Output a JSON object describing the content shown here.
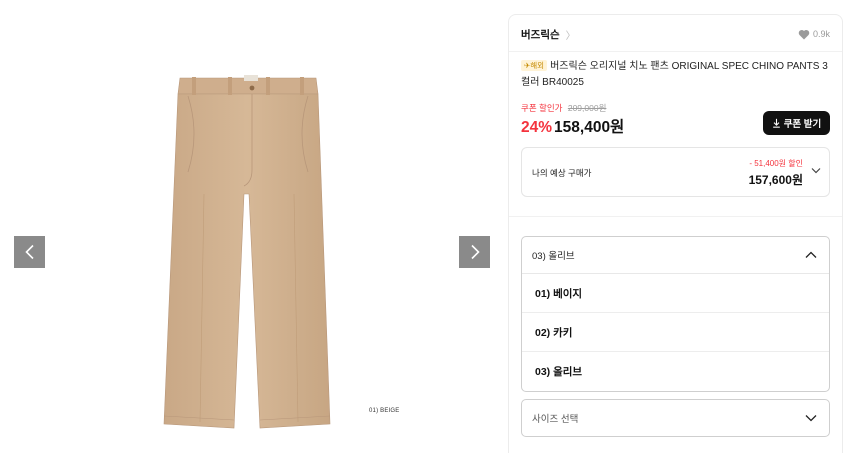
{
  "gallery": {
    "image_caption": "01) BEIGE",
    "product_color": "#d2b392"
  },
  "brand": {
    "name": "버즈릭슨",
    "chevron": "〉"
  },
  "likes": {
    "count": "0.9k"
  },
  "product": {
    "badge": "✈해외",
    "title": "버즈릭슨 오리지널 치노 팬츠 ORIGINAL SPEC CHINO PANTS 3컬러 BR40025"
  },
  "pricing": {
    "coupon_label": "쿠폰 할인가",
    "original_price": "209,000원",
    "discount_percent": "24%",
    "sale_price": "158,400원",
    "coupon_button": "쿠폰 받기"
  },
  "expected": {
    "label": "나의 예상 구매가",
    "discount": "- 51,400원 할인",
    "price": "157,600원"
  },
  "color_select": {
    "selected": "03) 올리브",
    "options": [
      "01) 베이지",
      "02) 카키",
      "03) 올리브"
    ]
  },
  "size_select": {
    "placeholder": "사이즈 선택"
  },
  "colors": {
    "accent_red": "#f4333d",
    "button_black": "#111111",
    "arrow_gray": "#8a8a8a"
  }
}
